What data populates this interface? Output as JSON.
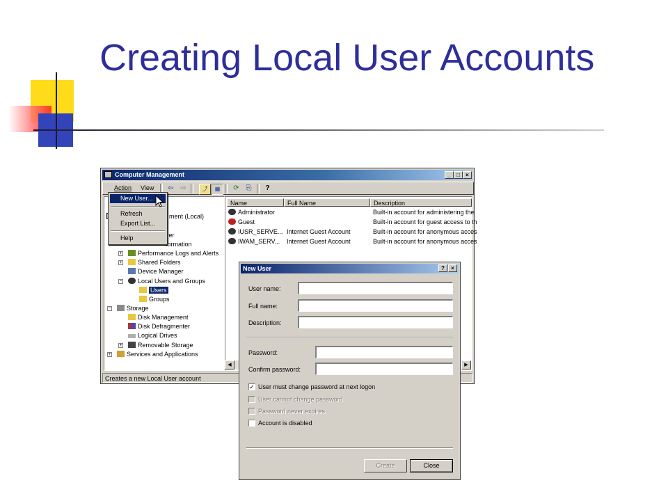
{
  "slide": {
    "title": "Creating Local User Accounts"
  },
  "main_window": {
    "title": "Computer Management",
    "caption_buttons": [
      "_",
      "□",
      "×"
    ],
    "menu": [
      "Action",
      "View"
    ],
    "toolbar_icons": [
      "back-arrow-icon",
      "forward-arrow-icon",
      "up-folder-icon",
      "show-tree-icon",
      "refresh-icon",
      "export-list-icon",
      "help-icon"
    ],
    "tree": {
      "root_partial": "ment (Local)",
      "partial_1": "ver",
      "partial_2": "formation",
      "items": [
        {
          "label": "Performance Logs and Alerts",
          "icon": "performance-icon"
        },
        {
          "label": "Shared Folders",
          "icon": "folder-icon"
        },
        {
          "label": "Device Manager",
          "icon": "device-manager-icon"
        },
        {
          "label": "Local Users and Groups",
          "icon": "users-groups-icon"
        },
        {
          "label": "Users",
          "icon": "folder-icon",
          "selected": true
        },
        {
          "label": "Groups",
          "icon": "folder-icon"
        },
        {
          "label": "Storage",
          "icon": "storage-icon"
        },
        {
          "label": "Disk Management",
          "icon": "folder-icon"
        },
        {
          "label": "Disk Defragmenter",
          "icon": "defrag-icon"
        },
        {
          "label": "Logical Drives",
          "icon": "drive-icon"
        },
        {
          "label": "Removable Storage",
          "icon": "removable-storage-icon"
        },
        {
          "label": "Services and Applications",
          "icon": "services-icon"
        }
      ]
    },
    "list": {
      "columns": [
        "Name",
        "Full Name",
        "Description"
      ],
      "rows": [
        {
          "name": "Administrator",
          "full_name": "",
          "description": "Built-in account for administering the"
        },
        {
          "name": "Guest",
          "full_name": "",
          "description": "Built-in account for guest access to th"
        },
        {
          "name": "IUSR_SERVE...",
          "full_name": "Internet Guest Account",
          "description": "Built-in account for anonymous acces"
        },
        {
          "name": "IWAM_SERV...",
          "full_name": "Internet Guest Account",
          "description": "Built-in account for anonymous acces"
        }
      ]
    },
    "status": "Creates a new Local User account"
  },
  "context_menu": {
    "items": [
      "New User...",
      "Refresh",
      "Export List...",
      "Help"
    ]
  },
  "new_user_dialog": {
    "title": "New User",
    "caption_buttons": [
      "?",
      "×"
    ],
    "fields": {
      "user_name": {
        "label": "User name:",
        "value": ""
      },
      "full_name": {
        "label": "Full name:",
        "value": ""
      },
      "description": {
        "label": "Description:",
        "value": ""
      },
      "password": {
        "label": "Password:",
        "value": ""
      },
      "confirm_password": {
        "label": "Confirm password:",
        "value": ""
      }
    },
    "checkboxes": [
      {
        "label": "User must change password at next logon",
        "checked": true,
        "enabled": true
      },
      {
        "label": "User cannot change password",
        "checked": false,
        "enabled": false
      },
      {
        "label": "Password never expires",
        "checked": false,
        "enabled": false
      },
      {
        "label": "Account is disabled",
        "checked": false,
        "enabled": true
      }
    ],
    "buttons": {
      "create": "Create",
      "close": "Close"
    }
  },
  "colors": {
    "title_text": "#2e2e9a",
    "titlebar_start": "#0a246a",
    "titlebar_end": "#a6caf0",
    "window_face": "#d4d0c8",
    "selection": "#0a246a"
  }
}
